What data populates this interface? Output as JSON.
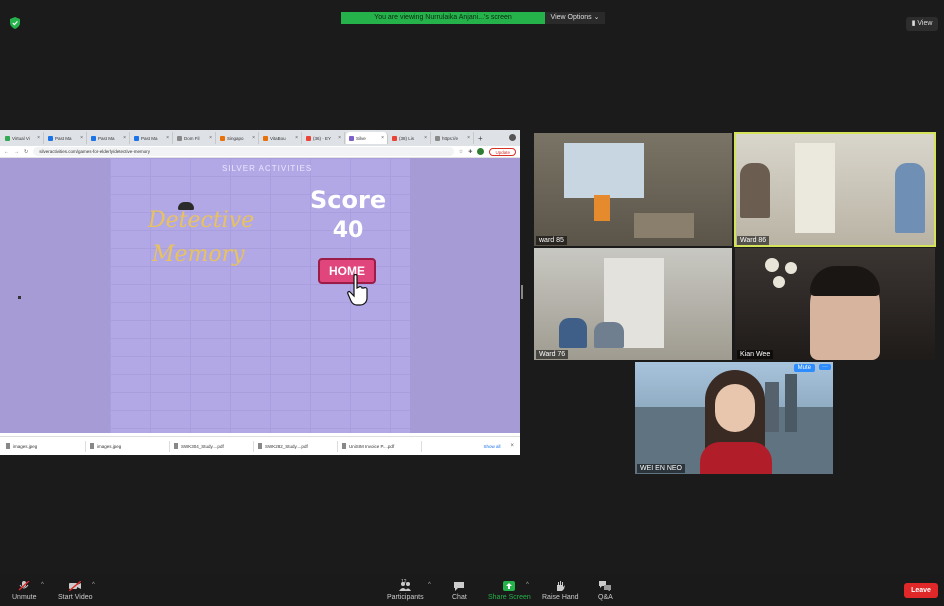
{
  "banner": {
    "viewing_text": "You are viewing Nurrulaika Anjani...'s screen",
    "view_options": "View Options ⌄",
    "view_button": "View"
  },
  "browser": {
    "tabs": [
      "Virtual Vi",
      "Past Ma",
      "Past Ma",
      "Past Ma",
      "Dom Fil",
      "Singapo",
      "VitaBou",
      "(36) · EY",
      "Silve",
      "(38) Lis",
      "https://e"
    ],
    "url": "silveractivities.com/games-for-elderly/detective-memory",
    "update_label": "Update",
    "downloads": [
      "images.jpeg",
      "images.jpeg",
      "SWK304_Study....pdf",
      "SWK282_Study....pdf",
      "UniSIM Invoice P....pdf"
    ],
    "show_all": "Show all"
  },
  "game": {
    "brand": "SILVER ACTIVITIES",
    "title_line1": "Detective",
    "title_line2": "Memory",
    "score_label": "Score",
    "score_value": "40",
    "home_label": "HOME"
  },
  "participants": [
    {
      "name": "ward 85"
    },
    {
      "name": "Ward 86"
    },
    {
      "name": "Ward 76"
    },
    {
      "name": "Kian Wee"
    },
    {
      "name": "WEI EN NEO",
      "mute_label": "Mute",
      "more_label": "···"
    }
  ],
  "toolbar": {
    "unmute": "Unmute",
    "start_video": "Start Video",
    "participants": "Participants",
    "participant_count": "12",
    "chat": "Chat",
    "share_screen": "Share Screen",
    "raise_hand": "Raise Hand",
    "qa": "Q&A",
    "leave": "Leave"
  },
  "colors": {
    "accent_green": "#25b24a",
    "leave_red": "#e02828",
    "highlight": "#d4e35a",
    "game_bg": "#b3a8e6",
    "home_pink": "#e0467c"
  }
}
